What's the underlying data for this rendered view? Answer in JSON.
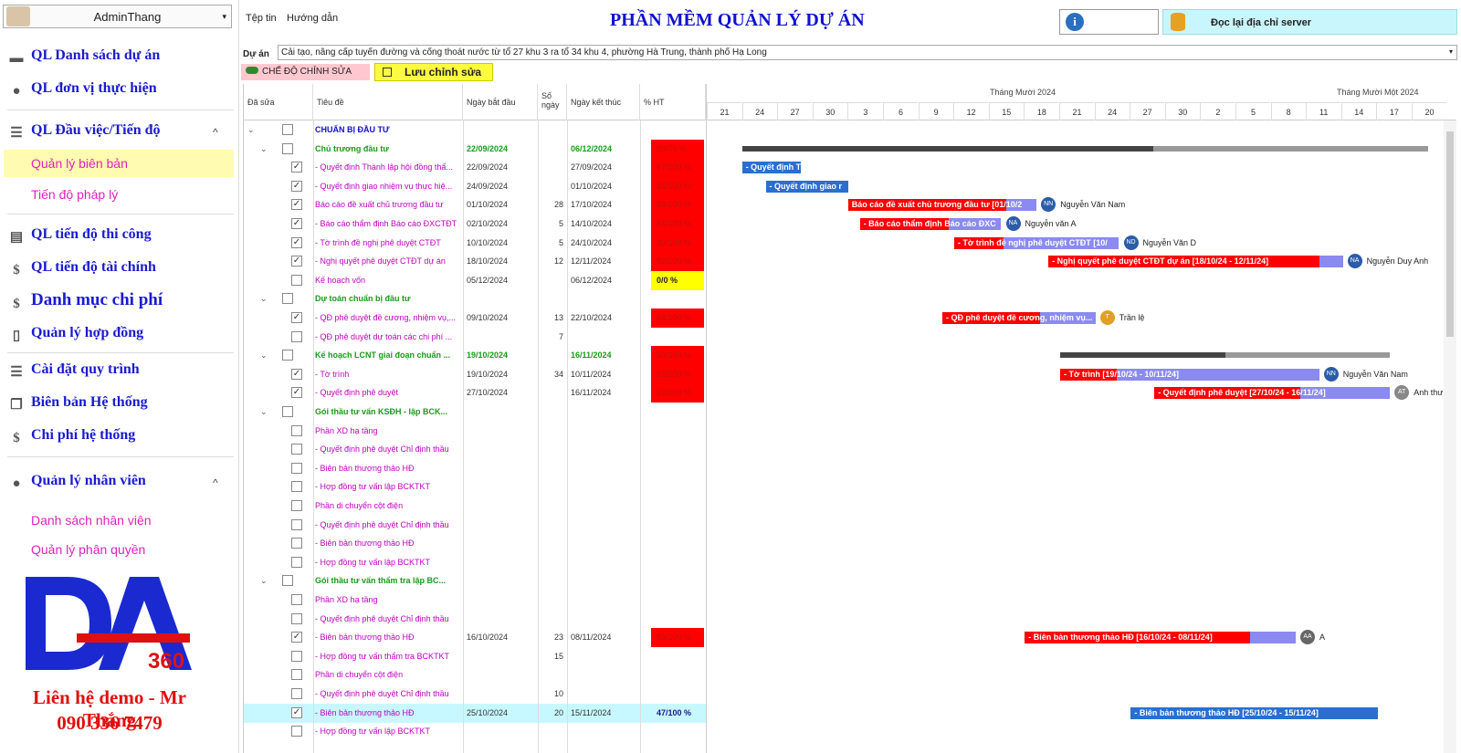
{
  "user": {
    "name": "AdminThang"
  },
  "menu": [
    "Tệp tin",
    "Hướng dẫn"
  ],
  "app_title": "PHẦN MỀM QUẢN LÝ DỰ ÁN",
  "server_button": "Đọc lại địa chỉ server",
  "sidebar": {
    "items": [
      {
        "label": "QL Danh sách dự án",
        "icon": "briefcase-icon"
      },
      {
        "label": "QL đơn vị thực hiện",
        "icon": "worker-icon"
      },
      {
        "label": "QL Đầu việc/Tiến độ",
        "icon": "list-icon"
      },
      {
        "label": "QL tiến độ thi công",
        "icon": "gantt-icon"
      },
      {
        "label": "QL tiến độ tài chính",
        "icon": "coins-icon"
      },
      {
        "label": "Danh mục chi phí",
        "icon": "money-icon"
      },
      {
        "label": "Quản lý hợp đồng",
        "icon": "document-icon"
      },
      {
        "label": "Cài đặt quy trình",
        "icon": "list-bullet-icon"
      },
      {
        "label": "Biên bản Hệ thống",
        "icon": "copy-icon"
      },
      {
        "label": "Chi phí hệ thống",
        "icon": "coins-icon"
      },
      {
        "label": "Quản lý nhân viên",
        "icon": "person-icon"
      }
    ],
    "sub_task": [
      "Quản lý biên bản",
      "Tiến độ pháp lý"
    ],
    "sub_staff": [
      "Danh sách nhân viên",
      "Quản lý phân quyền"
    ],
    "contact_line1": "Liên hệ demo - Mr Thắng",
    "contact_line2": "090 336 7479",
    "logo_text": "360"
  },
  "project": {
    "label": "Dự án",
    "value": "Cải tạo, nâng cấp tuyến đường và cống thoát nước từ tổ 27 khu 3 ra tổ 34 khu 4, phường Hà Trung, thành phố Hạ Long"
  },
  "edit_mode": "CHẾ ĐỘ CHỈNH SỬA",
  "save_button": "Lưu chỉnh sửa",
  "grid": {
    "headers": [
      "Đã sửa",
      "Tiêu đề",
      "Ngày bắt đầu",
      "Số ngày",
      "Ngày kết thúc",
      "% HT"
    ],
    "rows": [
      {
        "lvl": 0,
        "exp": true,
        "checked": false,
        "title": "CHUẨN BỊ ĐẦU TƯ",
        "kind": "root",
        "start": "",
        "days": "",
        "end": "",
        "pct": "",
        "pstyle": ""
      },
      {
        "lvl": 1,
        "exp": true,
        "checked": false,
        "title": "Chủ trương đầu tư",
        "kind": "group",
        "start": "22/09/2024",
        "days": "",
        "end": "06/12/2024",
        "pct": "50/79 %",
        "pstyle": "red"
      },
      {
        "lvl": 2,
        "checked": true,
        "title": " - Quyết định Thành lập hội đồng thẩ...",
        "kind": "title",
        "start": "22/09/2024",
        "days": "",
        "end": "27/09/2024",
        "pct": "67/100 %",
        "pstyle": "red"
      },
      {
        "lvl": 2,
        "checked": true,
        "title": " - Quyết định giao nhiệm vụ thực hiệ...",
        "kind": "title",
        "start": "24/09/2024",
        "days": "",
        "end": "01/10/2024",
        "pct": "84/100 %",
        "pstyle": "red"
      },
      {
        "lvl": 2,
        "checked": true,
        "title": "Báo cáo đề xuất chủ trương đầu tư",
        "kind": "title",
        "start": "01/10/2024",
        "days": "28",
        "end": "17/10/2024",
        "pct": "84/100 %",
        "pstyle": "red"
      },
      {
        "lvl": 2,
        "checked": true,
        "title": " - Báo cáo thẩm định Báo cáo ĐXCTĐT",
        "kind": "title",
        "start": "02/10/2024",
        "days": "5",
        "end": "14/10/2024",
        "pct": "63/100 %",
        "pstyle": "red"
      },
      {
        "lvl": 2,
        "checked": true,
        "title": " - Tờ trình đề nghị phê duyệt CTĐT",
        "kind": "title",
        "start": "10/10/2024",
        "days": "5",
        "end": "24/10/2024",
        "pct": "30/100 %",
        "pstyle": "red"
      },
      {
        "lvl": 2,
        "checked": true,
        "title": " - Nghị quyết phê duyệt CTĐT dự án",
        "kind": "title",
        "start": "18/10/2024",
        "days": "12",
        "end": "12/11/2024",
        "pct": "92/100 %",
        "pstyle": "red"
      },
      {
        "lvl": 2,
        "checked": false,
        "title": "Kế hoạch vốn",
        "kind": "title",
        "start": "05/12/2024",
        "days": "",
        "end": "06/12/2024",
        "pct": "0/0 %",
        "pstyle": "yel"
      },
      {
        "lvl": 1,
        "exp": true,
        "checked": false,
        "title": "Dự toán chuẩn bị đầu tư",
        "kind": "group",
        "start": "",
        "days": "",
        "end": "",
        "pct": "",
        "pstyle": ""
      },
      {
        "lvl": 2,
        "checked": true,
        "title": " - QĐ phê duyệt đề cương, nhiệm vụ,...",
        "kind": "title",
        "start": "09/10/2024",
        "days": "13",
        "end": "22/10/2024",
        "pct": "64/100 %",
        "pstyle": "red"
      },
      {
        "lvl": 2,
        "checked": false,
        "title": " - QĐ phê duyệt dự toán các chi phí ...",
        "kind": "title",
        "start": "",
        "days": "7",
        "end": "",
        "pct": "",
        "pstyle": ""
      },
      {
        "lvl": 1,
        "exp": true,
        "checked": false,
        "title": "Kế hoạch LCNT giai đoạn chuẩn ...",
        "kind": "group",
        "start": "19/10/2024",
        "days": "",
        "end": "16/11/2024",
        "pct": "50/100 %",
        "pstyle": "red"
      },
      {
        "lvl": 2,
        "checked": true,
        "title": " - Tờ trình",
        "kind": "title",
        "start": "19/10/2024",
        "days": "34",
        "end": "10/11/2024",
        "pct": "22/100 %",
        "pstyle": "red"
      },
      {
        "lvl": 2,
        "checked": true,
        "title": " - Quyết định phê duyệt",
        "kind": "title",
        "start": "27/10/2024",
        "days": "",
        "end": "16/11/2024",
        "pct": "62/100 %",
        "pstyle": "red"
      },
      {
        "lvl": 1,
        "exp": true,
        "checked": false,
        "title": "Gói thầu tư vấn KSĐH - lập BCK...",
        "kind": "group",
        "start": "",
        "days": "",
        "end": "",
        "pct": "",
        "pstyle": ""
      },
      {
        "lvl": 2,
        "checked": false,
        "title": "Phần XD hạ tầng",
        "kind": "title",
        "start": "",
        "days": "",
        "end": "",
        "pct": "",
        "pstyle": ""
      },
      {
        "lvl": 2,
        "checked": false,
        "title": " - Quyết định phê duyệt Chỉ định thầu",
        "kind": "title",
        "start": "",
        "days": "",
        "end": "",
        "pct": "",
        "pstyle": ""
      },
      {
        "lvl": 2,
        "checked": false,
        "title": " - Biên bản thương thảo HĐ",
        "kind": "title",
        "start": "",
        "days": "",
        "end": "",
        "pct": "",
        "pstyle": ""
      },
      {
        "lvl": 2,
        "checked": false,
        "title": " - Hợp đồng tư vấn lập BCKTKT",
        "kind": "title",
        "start": "",
        "days": "",
        "end": "",
        "pct": "",
        "pstyle": ""
      },
      {
        "lvl": 2,
        "checked": false,
        "title": "Phần di chuyển cột điện",
        "kind": "title",
        "start": "",
        "days": "",
        "end": "",
        "pct": "",
        "pstyle": ""
      },
      {
        "lvl": 2,
        "checked": false,
        "title": " - Quyết định phê duyệt Chỉ định thầu",
        "kind": "title",
        "start": "",
        "days": "",
        "end": "",
        "pct": "",
        "pstyle": ""
      },
      {
        "lvl": 2,
        "checked": false,
        "title": " - Biên bản thương thảo HĐ",
        "kind": "title",
        "start": "",
        "days": "",
        "end": "",
        "pct": "",
        "pstyle": ""
      },
      {
        "lvl": 2,
        "checked": false,
        "title": " - Hợp đồng tư vấn lập BCKTKT",
        "kind": "title",
        "start": "",
        "days": "",
        "end": "",
        "pct": "",
        "pstyle": ""
      },
      {
        "lvl": 1,
        "exp": true,
        "checked": false,
        "title": "Gói thầu tư vấn thẩm tra lập BC...",
        "kind": "group",
        "start": "",
        "days": "",
        "end": "",
        "pct": "",
        "pstyle": ""
      },
      {
        "lvl": 2,
        "checked": false,
        "title": "Phần XD hạ tầng",
        "kind": "title",
        "start": "",
        "days": "",
        "end": "",
        "pct": "",
        "pstyle": ""
      },
      {
        "lvl": 2,
        "checked": false,
        "title": " - Quyết định phê duyệt Chỉ định thầu",
        "kind": "title",
        "start": "",
        "days": "",
        "end": "",
        "pct": "",
        "pstyle": ""
      },
      {
        "lvl": 2,
        "checked": true,
        "title": " - Biên bản thương thảo HĐ",
        "kind": "title",
        "start": "16/10/2024",
        "days": "23",
        "end": "08/11/2024",
        "pct": "83/100 %",
        "pstyle": "red"
      },
      {
        "lvl": 2,
        "checked": false,
        "title": " - Hợp đồng tư vấn thẩm tra BCKTKT",
        "kind": "title",
        "start": "",
        "days": "15",
        "end": "",
        "pct": "",
        "pstyle": ""
      },
      {
        "lvl": 2,
        "checked": false,
        "title": "Phần di chuyển cột điện",
        "kind": "title",
        "start": "",
        "days": "",
        "end": "",
        "pct": "",
        "pstyle": ""
      },
      {
        "lvl": 2,
        "checked": false,
        "title": " - Quyết định phê duyệt Chỉ định thầu",
        "kind": "title",
        "start": "",
        "days": "10",
        "end": "",
        "pct": "",
        "pstyle": ""
      },
      {
        "lvl": 2,
        "checked": true,
        "title": " - Biên bản thương thảo HĐ",
        "kind": "title",
        "start": "25/10/2024",
        "days": "20",
        "end": "15/11/2024",
        "pct": "47/100 %",
        "pstyle": "ok",
        "hl": true
      },
      {
        "lvl": 2,
        "checked": false,
        "title": " - Hợp đồng tư vấn lập BCKTKT",
        "kind": "title",
        "start": "",
        "days": "",
        "end": "",
        "pct": "",
        "pstyle": ""
      }
    ]
  },
  "gantt": {
    "months": [
      "Tháng Mười 2024",
      "Tháng Mười Một 2024"
    ],
    "days": [
      "21",
      "24",
      "27",
      "30",
      "3",
      "6",
      "9",
      "12",
      "15",
      "18",
      "21",
      "24",
      "27",
      "30",
      "2",
      "5",
      "8",
      "11",
      "14",
      "17",
      "20"
    ],
    "summaries": [
      {
        "row": 1,
        "start": "2024-09-22",
        "end": "2024-12-06",
        "done": 0.6
      },
      {
        "row": 12,
        "start": "2024-10-19",
        "end": "2024-11-16",
        "done": 0.5
      }
    ],
    "tasks": [
      {
        "row": 2,
        "label": "- Quyết định T",
        "start": "2024-09-22",
        "end": "2024-09-27",
        "done": 0,
        "color": "#2a6fd0",
        "initials": "",
        "person": ""
      },
      {
        "row": 3,
        "label": "- Quyết định giao r",
        "start": "2024-09-24",
        "end": "2024-10-01",
        "done": 0,
        "color": "#2a6fd0",
        "initials": "",
        "person": ""
      },
      {
        "row": 4,
        "label": "Báo cáo đề xuất chủ trương đầu tư [01/10/2",
        "start": "2024-10-01",
        "end": "2024-10-17",
        "done": 0.84,
        "color": "#8a8af0",
        "initials": "NN",
        "person": "Nguyễn Văn Nam"
      },
      {
        "row": 5,
        "label": "- Báo cáo thẩm định Báo cáo ĐXC",
        "start": "2024-10-02",
        "end": "2024-10-14",
        "done": 0.63,
        "color": "#8a8af0",
        "initials": "NA",
        "person": "Nguyễn văn A"
      },
      {
        "row": 6,
        "label": "- Tờ trình đề nghị phê duyệt CTĐT [10/",
        "start": "2024-10-10",
        "end": "2024-10-24",
        "done": 0.3,
        "color": "#8a8af0",
        "initials": "ND",
        "person": "Nguyễn Văn D"
      },
      {
        "row": 7,
        "label": "- Nghị quyết phê duyệt CTĐT dự án [18/10/24 - 12/11/24]",
        "start": "2024-10-18",
        "end": "2024-11-12",
        "done": 0.92,
        "color": "#8a8af0",
        "initials": "NA",
        "person": "Nguyễn Duy Anh"
      },
      {
        "row": 10,
        "label": "- QĐ phê duyệt đề cương, nhiệm vụ...",
        "start": "2024-10-09",
        "end": "2024-10-22",
        "done": 0.64,
        "color": "#8a8af0",
        "initials": "T",
        "person": "Trần lệ",
        "avatar_color": "#e0a020"
      },
      {
        "row": 13,
        "label": "- Tờ trình [19/10/24 - 10/11/24]",
        "start": "2024-10-19",
        "end": "2024-11-10",
        "done": 0.22,
        "color": "#8a8af0",
        "initials": "NN",
        "person": "Nguyễn Văn Nam"
      },
      {
        "row": 14,
        "label": "- Quyết định phê duyệt [27/10/24 - 16/11/24]",
        "start": "2024-10-27",
        "end": "2024-11-16",
        "done": 0.62,
        "color": "#8a8af0",
        "initials": "AT",
        "person": "Anh thư",
        "avatar_color": "#888"
      },
      {
        "row": 27,
        "label": "- Biên bản thương thảo HĐ [16/10/24 - 08/11/24]",
        "start": "2024-10-16",
        "end": "2024-11-08",
        "done": 0.83,
        "color": "#8a8af0",
        "initials": "AA",
        "person": "A",
        "avatar_color": "#666"
      },
      {
        "row": 31,
        "label": "- Biên bản thương thảo HĐ [25/10/24 - 15/11/24]",
        "start": "2024-10-25",
        "end": "2024-11-15",
        "done": 0,
        "color": "#2a6fd0",
        "initials": "",
        "person": ""
      }
    ]
  }
}
